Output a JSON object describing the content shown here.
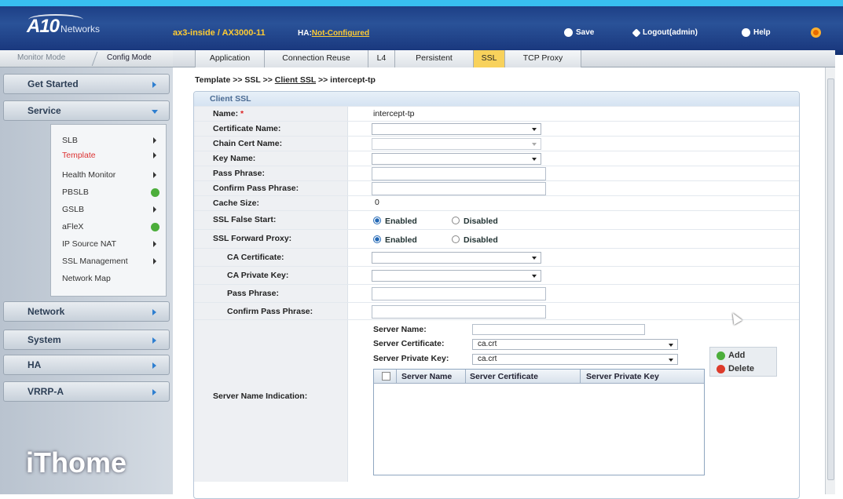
{
  "header": {
    "logo_main": "A10",
    "logo_sub": "Networks",
    "device": "ax3-inside / AX3000-11",
    "ha_label": "HA:",
    "ha_value": "Not-Configured",
    "save": "Save",
    "logout": "Logout(admin)",
    "help": "Help"
  },
  "mode": {
    "monitor": "Monitor Mode",
    "config": "Config Mode"
  },
  "tabs": [
    "Application",
    "Connection Reuse",
    "L4",
    "Persistent",
    "SSL",
    "TCP Proxy"
  ],
  "active_tab": "SSL",
  "sidebar": {
    "groups": [
      "Get Started",
      "Service",
      "Network",
      "System",
      "HA",
      "VRRP-A"
    ],
    "service_items": [
      "SLB",
      "Template",
      "Health Monitor",
      "PBSLB",
      "GSLB",
      "aFleX",
      "IP Source NAT",
      "SSL Management",
      "Network Map"
    ],
    "active_item": "Template"
  },
  "breadcrumb": {
    "prefix": "Template >> SSL >> ",
    "link": "Client SSL",
    "suffix": " >> intercept-tp"
  },
  "form": {
    "title": "Client SSL",
    "name_label": "Name:",
    "name_value": "intercept-tp",
    "certificate_name_label": "Certificate Name:",
    "chain_cert_name_label": "Chain Cert Name:",
    "key_name_label": "Key Name:",
    "pass_phrase_label": "Pass Phrase:",
    "confirm_pass_phrase_label": "Confirm Pass Phrase:",
    "cache_size_label": "Cache Size:",
    "cache_size_value": "0",
    "ssl_false_start_label": "SSL False Start:",
    "ssl_forward_proxy_label": "SSL Forward Proxy:",
    "enabled": "Enabled",
    "disabled": "Disabled",
    "ca_certificate_label": "CA Certificate:",
    "ca_private_key_label": "CA Private Key:",
    "proxy_pass_phrase_label": "Pass Phrase:",
    "proxy_confirm_pass_phrase_label": "Confirm Pass Phrase:",
    "sni_label": "Server Name Indication:",
    "server_name_label": "Server Name:",
    "server_certificate_label": "Server Certificate:",
    "server_certificate_value": "ca.crt",
    "server_private_key_label": "Server Private Key:",
    "server_private_key_value": "ca.crt",
    "table_headers": [
      "Server Name",
      "Server Certificate",
      "Server Private Key"
    ],
    "add": "Add",
    "delete": "Delete"
  },
  "watermark": "iThome"
}
